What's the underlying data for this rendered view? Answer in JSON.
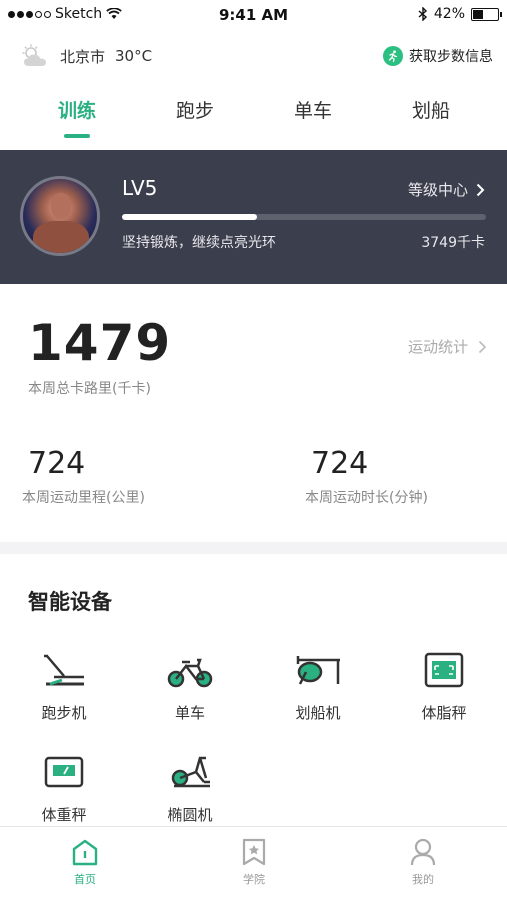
{
  "status_bar": {
    "carrier": "Sketch",
    "time": "9:41 AM",
    "battery": "42%",
    "battery_level": 0.42
  },
  "weather": {
    "city": "北京市",
    "temperature": "30°C",
    "icon": "cloudy-sun-icon"
  },
  "steps_button": {
    "label": "获取步数信息",
    "icon": "runner-icon"
  },
  "tabs": [
    {
      "label": "训练",
      "active": true
    },
    {
      "label": "跑步",
      "active": false
    },
    {
      "label": "单车",
      "active": false
    },
    {
      "label": "划船",
      "active": false
    }
  ],
  "level_card": {
    "level": "LV5",
    "level_center": "等级中心",
    "motto": "坚持锻炼，继续点亮光环",
    "calories": "3749千卡",
    "progress": 0.37
  },
  "stats": {
    "weekly_calories": "1479",
    "weekly_calories_caption": "本周总卡路里(千卡)",
    "stats_link": "运动统计",
    "weekly_distance": "724",
    "weekly_distance_caption": "本周运动里程(公里)",
    "weekly_duration": "724",
    "weekly_duration_caption": "本周运动时长(分钟)"
  },
  "devices": {
    "title": "智能设备",
    "items": [
      {
        "label": "跑步机",
        "icon": "treadmill-icon"
      },
      {
        "label": "单车",
        "icon": "bicycle-icon"
      },
      {
        "label": "划船机",
        "icon": "rowing-machine-icon"
      },
      {
        "label": "体脂秤",
        "icon": "body-fat-scale-icon"
      },
      {
        "label": "体重秤",
        "icon": "weight-scale-icon"
      },
      {
        "label": "椭圆机",
        "icon": "elliptical-icon"
      }
    ]
  },
  "bottom_nav": [
    {
      "label": "首页",
      "icon": "home-icon",
      "active": true
    },
    {
      "label": "学院",
      "icon": "bookmark-icon",
      "active": false
    },
    {
      "label": "我的",
      "icon": "profile-icon",
      "active": false
    }
  ],
  "colors": {
    "accent": "#2bb082",
    "card": "#3b3e4c"
  }
}
